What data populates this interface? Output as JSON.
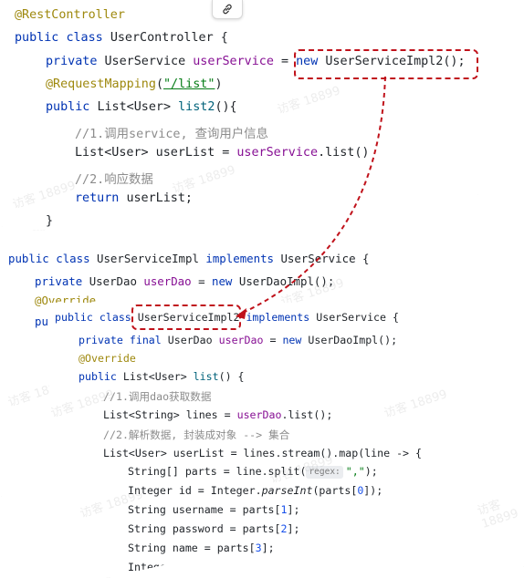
{
  "toolbar": {
    "link_icon": "link-icon"
  },
  "snippet1": {
    "anno_rest": "@RestController",
    "kw_public": "public",
    "kw_class": "class",
    "class_name": "UserController {",
    "kw_private": "private",
    "type_service": "UserService",
    "field_service": "userService",
    "eq": "=",
    "kw_new": "new",
    "ctor_impl2": "UserServiceImpl2();",
    "anno_mapping": "@RequestMapping",
    "mapping_open": "(",
    "mapping_path": "\"/list\"",
    "mapping_close": ")",
    "return_type": "List<User>",
    "method_name": "list2",
    "method_suffix": "(){",
    "comment1": "//1.调用service, 查询用户信息",
    "userlist_decl": "List<User> userList = ",
    "userlist_call": ".list()",
    "comment2": "//2.响应数据",
    "kw_return": "return",
    "return_value": "userList;",
    "close_brace": "}"
  },
  "snippet2": {
    "class_name": "UserServiceImpl",
    "kw_implements": "implements",
    "iface": "UserService {",
    "type_dao": "UserDao",
    "field_dao": "userDao",
    "ctor_dao": "UserDaoImpl();",
    "anno_override": "@Override",
    "pub_partial": "pu"
  },
  "snippet3": {
    "class_name": "UserServiceImpl2",
    "kw_final": "final",
    "anno_override": "@Override",
    "method_list": "list",
    "method_suffix": "() {",
    "comment1": "//1.调用dao获取数据",
    "lines_decl": "List<String> lines = ",
    "lines_call": ".list();",
    "comment2": "//2.解析数据, 封装成对象 --> 集合",
    "stream_line": "List<User> userList = lines.stream().map(line -> {",
    "parts_decl": "String[] parts = line.split(",
    "regex_hint": "regex:",
    "parts_arg": "\",\"",
    "parts_end": ");",
    "id_decl": "Integer id = Integer.",
    "parseint": "parseInt",
    "id_arg_open": "(parts[",
    "idx0": "0",
    "id_arg_close": "]);",
    "username_decl": "String username = parts[",
    "idx1": "1",
    "password_decl": "String password = parts[",
    "idx2": "2",
    "name_decl": "String name = parts[",
    "idx3": "3",
    "idx_close": "];",
    "age_partial": "Integer age = Inte"
  },
  "watermark": "访客 18899",
  "colors": {
    "keyword": "#0033b3",
    "annotation": "#9e880d",
    "field": "#871094",
    "method": "#00627a",
    "string": "#067d17",
    "comment": "#8c8c8c",
    "number": "#1750eb",
    "highlight": "#c0121b"
  }
}
